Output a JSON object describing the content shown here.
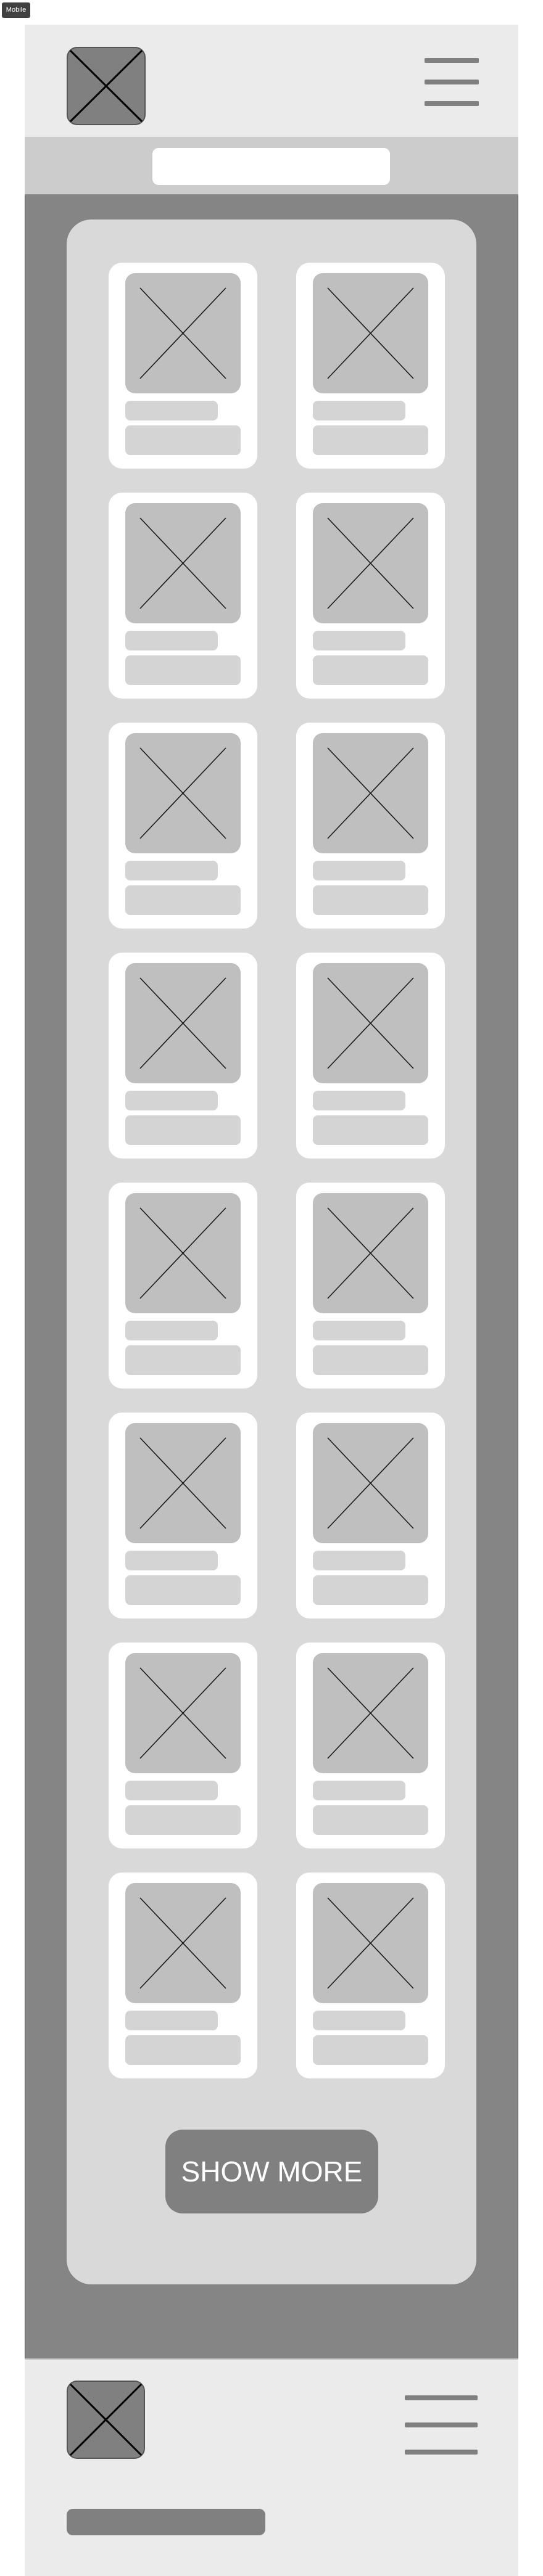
{
  "frame": {
    "label": "Mobile"
  },
  "header": {
    "logo_icon": "image-placeholder-icon",
    "menu_icon": "hamburger-menu-icon"
  },
  "search": {
    "placeholder": "",
    "value": ""
  },
  "products": {
    "count": 16,
    "thumb_icon": "image-placeholder-icon"
  },
  "show_more": {
    "label": "SHOW MORE"
  },
  "footer": {
    "logo_icon": "image-placeholder-icon",
    "menu_icon": "hamburger-menu-icon"
  },
  "colors": {
    "header_bg": "#ebebeb",
    "search_band": "#cccccc",
    "main_bg": "#858585",
    "panel_bg": "#d9d9d9",
    "card_bg": "#ffffff",
    "placeholder": "#bfbfbf",
    "text_line": "#d4d4d4",
    "button": "#808080"
  }
}
